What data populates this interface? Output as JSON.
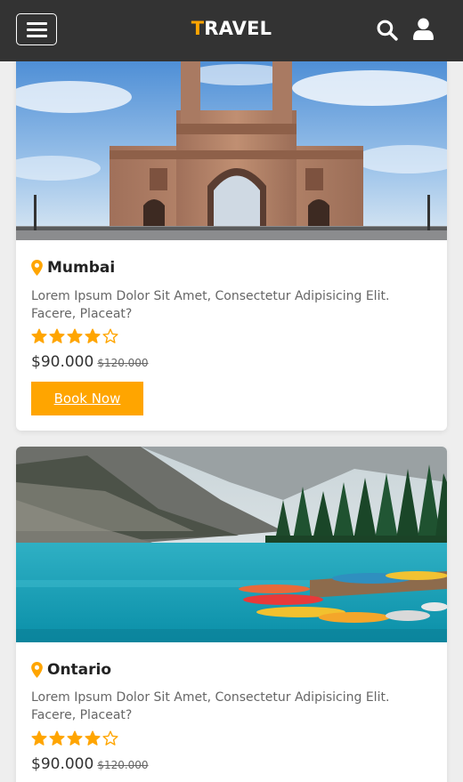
{
  "header": {
    "logo_first": "T",
    "logo_rest": "RAVEL"
  },
  "colors": {
    "accent": "#ffa500",
    "header_bg": "#333333"
  },
  "icons": [
    "menu-icon",
    "search-icon",
    "user-icon",
    "map-pin-icon",
    "star-filled-icon",
    "star-outline-icon"
  ],
  "cards": [
    {
      "city": "Mumbai",
      "description": "Lorem Ipsum Dolor Sit Amet, Consectetur Adipisicing Elit. Facere, Placeat?",
      "rating": 4,
      "rating_max": 5,
      "price": "$90.000",
      "old_price": "$120.000",
      "button": "Book Now"
    },
    {
      "city": "Ontario",
      "description": "Lorem Ipsum Dolor Sit Amet, Consectetur Adipisicing Elit. Facere, Placeat?",
      "rating": 4,
      "rating_max": 5,
      "price": "$90.000",
      "old_price": "$120.000"
    }
  ]
}
